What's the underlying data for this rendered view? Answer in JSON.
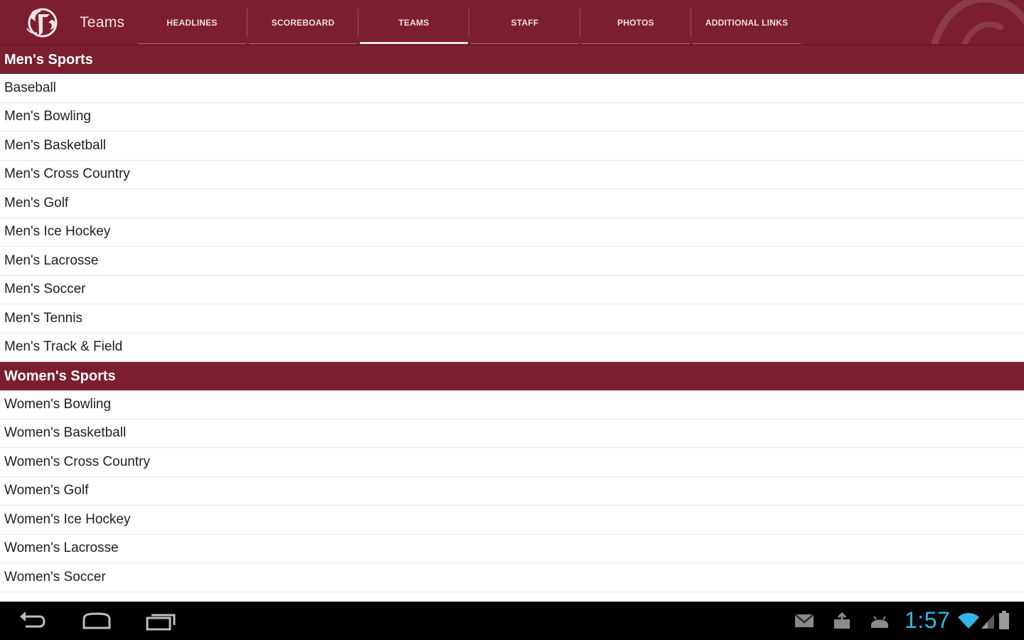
{
  "app": {
    "title": "Teams",
    "logo_icon": "college-monogram-logo-icon",
    "bar_color": "#7b1f2e"
  },
  "tabs": [
    {
      "label": "HEADLINES",
      "selected": false
    },
    {
      "label": "SCOREBOARD",
      "selected": false
    },
    {
      "label": "TEAMS",
      "selected": true
    },
    {
      "label": "STAFF",
      "selected": false
    },
    {
      "label": "PHOTOS",
      "selected": false
    },
    {
      "label": "ADDITIONAL LINKS",
      "selected": false
    }
  ],
  "sections": [
    {
      "title": "Men's Sports",
      "items": [
        "Baseball",
        "Men's Bowling",
        "Men's Basketball",
        "Men's Cross Country",
        "Men's Golf",
        "Men's Ice Hockey",
        "Men's Lacrosse",
        "Men's Soccer",
        "Men's Tennis",
        "Men's Track & Field"
      ]
    },
    {
      "title": "Women's Sports",
      "items": [
        "Women's Bowling",
        "Women's Basketball",
        "Women's Cross Country",
        "Women's Golf",
        "Women's Ice Hockey",
        "Women's Lacrosse",
        "Women's Soccer"
      ]
    }
  ],
  "system_bar": {
    "time": "1:57",
    "clock_color": "#33b5e5",
    "nav_icons": [
      "back-icon",
      "home-icon",
      "recent-apps-icon"
    ],
    "status_icons": [
      "gmail-notification-icon",
      "upload-notification-icon",
      "android-debug-icon",
      "wifi-icon",
      "cell-signal-icon",
      "battery-icon"
    ]
  }
}
